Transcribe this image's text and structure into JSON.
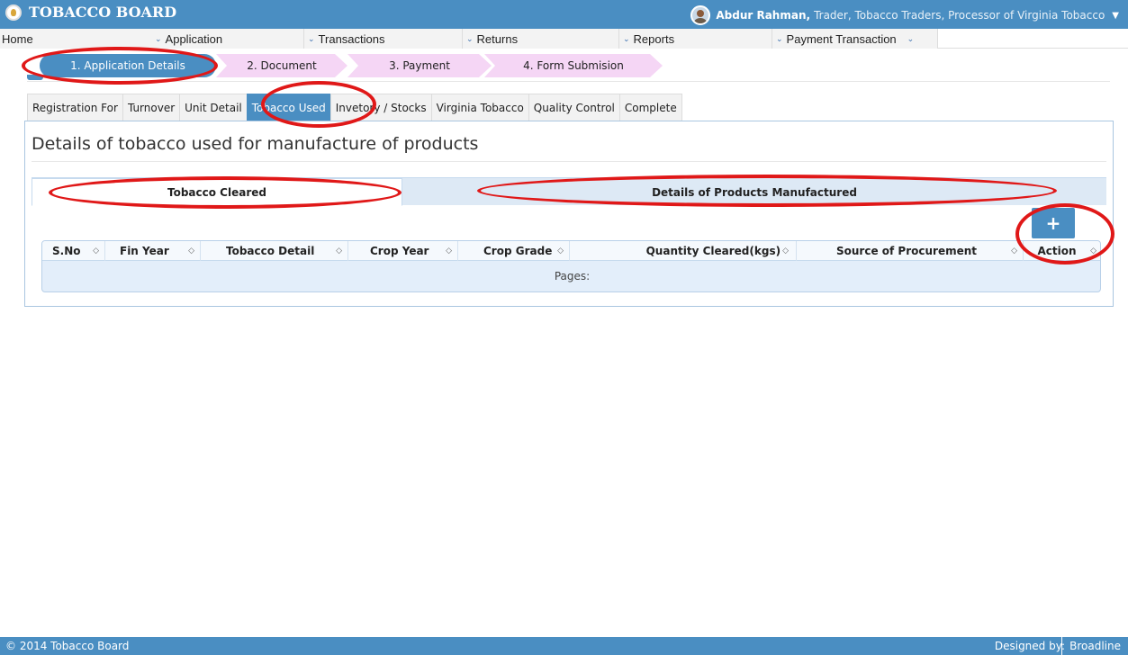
{
  "header": {
    "brand": "TOBACCO BOARD",
    "user_name": "Abdur Rahman,",
    "user_role": "Trader, Tobacco Traders, Processor of Virginia Tobacco"
  },
  "menu": [
    {
      "label": "Home"
    },
    {
      "label": "Application"
    },
    {
      "label": "Transactions"
    },
    {
      "label": "Returns"
    },
    {
      "label": "Reports"
    },
    {
      "label": "Payment Transaction"
    }
  ],
  "steps": [
    {
      "label": "1. Application Details"
    },
    {
      "label": "2. Document"
    },
    {
      "label": "3. Payment"
    },
    {
      "label": "4. Form Submision"
    }
  ],
  "tabs": [
    {
      "label": "Registration For"
    },
    {
      "label": "Turnover"
    },
    {
      "label": "Unit Detail"
    },
    {
      "label": "Tobacco Used"
    },
    {
      "label": "Invetory / Stocks"
    },
    {
      "label": "Virginia Tobacco"
    },
    {
      "label": "Quality Control"
    },
    {
      "label": "Complete"
    }
  ],
  "panel": {
    "title": "Details of tobacco used for manufacture of products",
    "subtabs": [
      {
        "label": "Tobacco Cleared"
      },
      {
        "label": "Details of Products Manufactured"
      }
    ],
    "add_label": "+",
    "columns": [
      {
        "label": "S.No"
      },
      {
        "label": "Fin Year"
      },
      {
        "label": "Tobacco Detail"
      },
      {
        "label": "Crop Year"
      },
      {
        "label": "Crop Grade"
      },
      {
        "label": "Quantity Cleared(kgs)"
      },
      {
        "label": "Source of Procurement"
      },
      {
        "label": "Action"
      }
    ],
    "pages_label": "Pages:"
  },
  "footer": {
    "copyright": "© 2014 Tobacco Board",
    "designed_by": "Designed by:",
    "designer": "Broadline"
  },
  "colors": {
    "primary": "#4a8ec2",
    "step_pink": "#f5d6f5",
    "annotation": "#e01818"
  }
}
